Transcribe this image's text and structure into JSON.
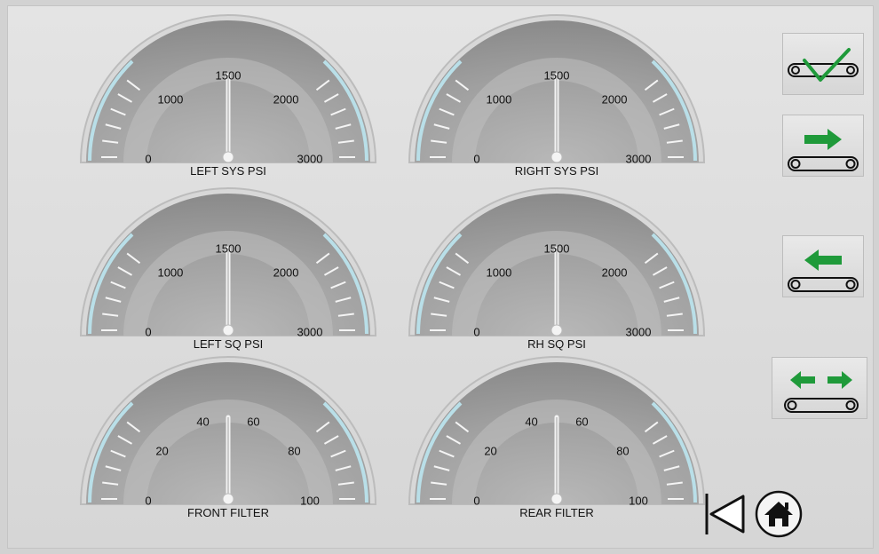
{
  "gauges": [
    {
      "title": "LEFT SYS PSI",
      "labels": [
        "0",
        "1000",
        "1500",
        "2000",
        "3000"
      ],
      "value": 1500,
      "min": 0,
      "max": 3000
    },
    {
      "title": "RIGHT SYS PSI",
      "labels": [
        "0",
        "1000",
        "1500",
        "2000",
        "3000"
      ],
      "value": 1500,
      "min": 0,
      "max": 3000
    },
    {
      "title": "LEFT SQ PSI",
      "labels": [
        "0",
        "1000",
        "1500",
        "2000",
        "3000"
      ],
      "value": 1500,
      "min": 0,
      "max": 3000
    },
    {
      "title": "RH SQ PSI",
      "labels": [
        "0",
        "1000",
        "1500",
        "2000",
        "3000"
      ],
      "value": 1500,
      "min": 0,
      "max": 3000
    },
    {
      "title": "FRONT FILTER",
      "labels": [
        "0",
        "20",
        "40",
        "60",
        "80",
        "100"
      ],
      "value": 50,
      "min": 0,
      "max": 100
    },
    {
      "title": "REAR FILTER",
      "labels": [
        "0",
        "20",
        "40",
        "60",
        "80",
        "100"
      ],
      "value": 50,
      "min": 0,
      "max": 100
    }
  ],
  "buttons": {
    "confirm": "checkmark-conveyor-icon",
    "forward": "arrow-right-conveyor-icon",
    "reverse": "arrow-left-conveyor-icon",
    "both": "arrows-both-conveyor-icon",
    "back": "back-triangle-icon",
    "home": "home-icon"
  },
  "colors": {
    "accent_green": "#1f9a3a",
    "needle": "#f2f2f2",
    "gauge_face": "#9a9a9a"
  }
}
